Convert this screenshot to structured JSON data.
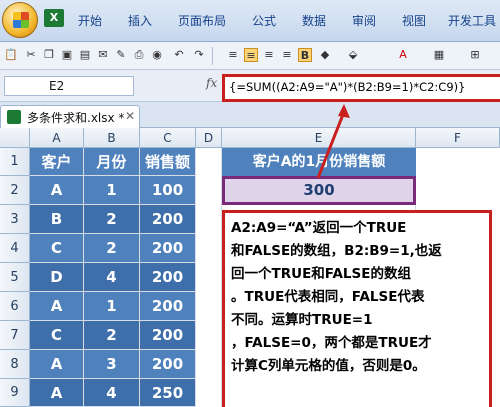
{
  "ribbon": {
    "tabs": [
      "开始",
      "插入",
      "页面布局",
      "公式",
      "数据",
      "审阅",
      "视图",
      "开发工具"
    ]
  },
  "toolbar": {
    "icons": [
      "paste-icon",
      "cut-icon",
      "copy-icon",
      "print-icon",
      "format-painter-icon",
      "undo-icon",
      "redo-icon",
      "bold-icon",
      "align-left-icon",
      "align-center-icon",
      "align-right-icon",
      "fill-color-icon",
      "font-color-icon",
      "border-icon"
    ],
    "bold_label": "B",
    "font_color_label": "A"
  },
  "formula_bar": {
    "name_box": "E2",
    "fx_label": "fx",
    "formula": "{=SUM((A2:A9=\"A\")*(B2:B9=1)*C2:C9)}"
  },
  "workbook": {
    "tab_name": "多条件求和.xlsx *"
  },
  "grid": {
    "columns": [
      "A",
      "B",
      "C",
      "D",
      "E",
      "F"
    ],
    "rows": [
      "1",
      "2",
      "3",
      "4",
      "5",
      "6",
      "7",
      "8",
      "9"
    ],
    "headers": [
      "客户",
      "月份",
      "销售额"
    ],
    "data": [
      [
        "A",
        "1",
        "100"
      ],
      [
        "B",
        "2",
        "200"
      ],
      [
        "C",
        "2",
        "200"
      ],
      [
        "D",
        "4",
        "200"
      ],
      [
        "A",
        "1",
        "200"
      ],
      [
        "C",
        "2",
        "200"
      ],
      [
        "A",
        "3",
        "200"
      ],
      [
        "A",
        "4",
        "250"
      ]
    ],
    "e_header": "客户A的1月份销售额",
    "e_value": "300"
  },
  "note": {
    "lines": [
      "A2:A9=“A”返回一个TRUE",
      "和FALSE的数组，B2:B9=1,也返",
      "回一个TRUE和FALSE的数组",
      "。TRUE代表相同，FALSE代表",
      "不同。运算时TRUE=1",
      "，FALSE=0，两个都是TRUE才",
      "计算C列单元格的值，否则是0。"
    ]
  },
  "colors": {
    "accent": "#4f81bd",
    "highlight_border": "#c9201f",
    "value_border": "#7a2a7a"
  }
}
